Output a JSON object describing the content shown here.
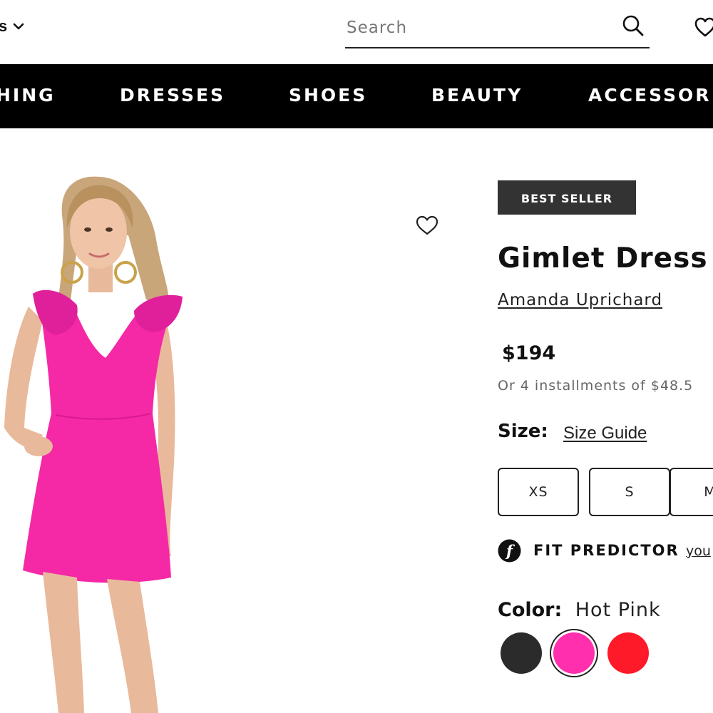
{
  "header": {
    "region_label": "s",
    "search_placeholder": "Search"
  },
  "nav": {
    "items": [
      "HING",
      "DRESSES",
      "SHOES",
      "BEAUTY",
      "ACCESSOR"
    ]
  },
  "product": {
    "badge": "BEST SELLER",
    "title": "Gimlet Dress",
    "brand": "Amanda Uprichard",
    "price": "$194",
    "installments": "Or 4 installments of $48.5",
    "size_label": "Size:",
    "size_guide": "Size Guide",
    "sizes": [
      "XS",
      "S",
      "M"
    ],
    "fit_predictor_label": "FIT PREDICTOR",
    "fit_predictor_link": "you",
    "color_label": "Color:",
    "color_value": "Hot Pink",
    "colors": [
      {
        "name": "black",
        "hex": "#2b2b2b",
        "selected": false
      },
      {
        "name": "hot-pink",
        "hex": "#ff2fae",
        "selected": true
      },
      {
        "name": "red",
        "hex": "#ff1a2a",
        "selected": false
      }
    ]
  },
  "image": {
    "dress_color": "#f528a6"
  }
}
